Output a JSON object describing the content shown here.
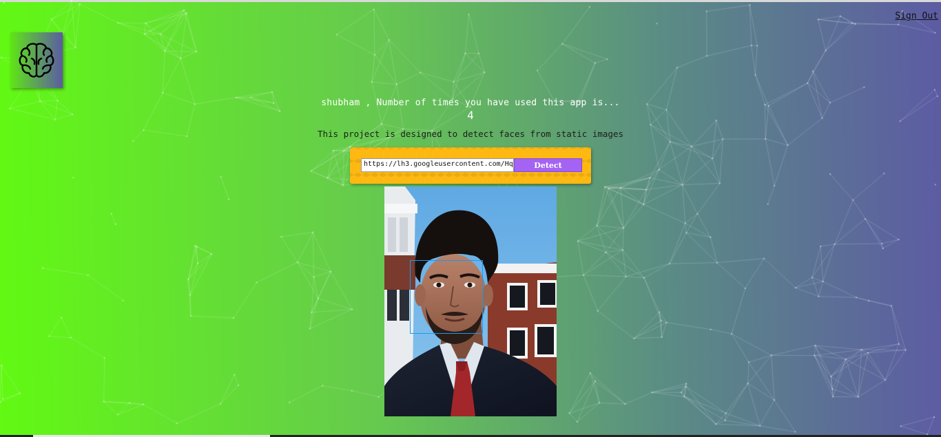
{
  "nav": {
    "sign_out_label": "Sign Out"
  },
  "logo": {
    "icon": "brain-icon"
  },
  "greeting": {
    "text": "shubham , Number of times you have used this app is...",
    "count": "4"
  },
  "description": "This project is designed to detect faces from static images",
  "detect_form": {
    "url_value": "https://lh3.googleusercontent.com/Hq",
    "button_label": "Detect"
  },
  "colors": {
    "gradient_left": "#62f913",
    "gradient_right": "#5c5ba3",
    "form_background": "#fdb811",
    "detect_button": "#a463f2",
    "face_box_border": "#149df2"
  }
}
